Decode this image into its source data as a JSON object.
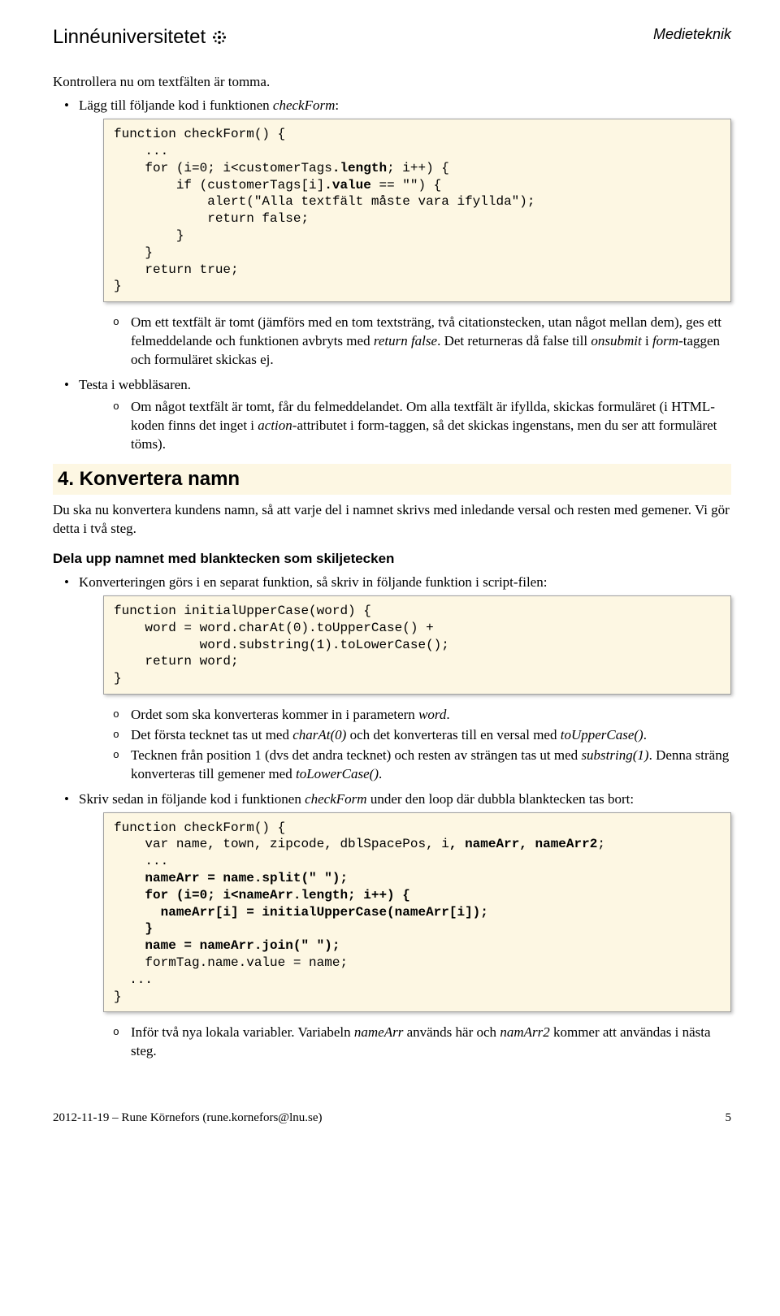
{
  "header": {
    "logo_text": "Linnéuniversitetet",
    "right": "Medieteknik"
  },
  "intro": "Kontrollera nu om textfälten är tomma.",
  "bullet1": {
    "pre": "Lägg till följande kod i funktionen ",
    "em": "checkForm",
    "post": ":"
  },
  "code1_plain": "function checkForm() {\n    ...\n    for (i=0; i<customerTags",
  "code1_bold": ".length",
  "code1_plain2": "; i++) {\n        if (customerTags[i]",
  "code1_bold2": ".value",
  "code1_plain3": " == \"\") {\n            alert(\"Alla textfält måste vara ifyllda\");\n            return false;\n        }\n    }\n    return true;\n}",
  "sub1": {
    "a": "Om ett textfält är tomt (jämförs med en tom textsträng, två citationstecken, utan något mellan dem), ges ett felmeddelande och funktionen avbryts med ",
    "a_em": "return false",
    "a2": ". Det returneras då false till ",
    "a_em2": "onsubmit",
    "a3": " i ",
    "a_em3": "form",
    "a4": "-taggen och formuläret skickas ej."
  },
  "bullet2": "Testa i webbläsaren.",
  "sub2": {
    "a": "Om något textfält är tomt, får du felmeddelandet. Om alla textfält är ifyllda, skickas formuläret (i HTML-koden finns det inget i ",
    "a_em": "action",
    "a2": "-attributet i form-taggen, så det skickas ingenstans, men du ser att formuläret töms)."
  },
  "section4": "4. Konvertera namn",
  "section4_para": "Du ska nu konvertera kundens namn, så att varje del i namnet skrivs med inledande versal och resten med gemener. Vi gör detta i två steg.",
  "subsection_h": "Dela upp namnet med blanktecken som skiljetecken",
  "bullet3": "Konverteringen görs i en separat funktion, så skriv in följande funktion i script-filen:",
  "code2": "function initialUpperCase(word) {\n    word = word.charAt(0).toUpperCase() +\n           word.substring(1).toLowerCase();\n    return word;\n}",
  "sub3": {
    "a": "Ordet som ska konverteras kommer in i parametern ",
    "a_em": "word",
    "a2": ".",
    "b": "Det första tecknet tas ut med ",
    "b_em": "charAt(0)",
    "b2": " och det konverteras till en versal med ",
    "b_em2": "toUpperCase()",
    "b3": ".",
    "c": "Tecknen från position 1 (dvs det andra tecknet) och resten av strängen tas ut med ",
    "c_em": "substring(1)",
    "c2": ". Denna sträng konverteras till gemener med ",
    "c_em2": "toLowerCase()",
    "c3": "."
  },
  "bullet4": {
    "pre": "Skriv sedan in följande kod i funktionen ",
    "em": "checkForm",
    "post": " under den loop där dubbla blanktecken tas bort:"
  },
  "code3_a": "function checkForm() {\n    var name, town, zipcode, dblSpacePos, i",
  "code3_bold": ", nameArr, nameArr2",
  "code3_b": ";\n    ...\n    ",
  "code3_bold2": "nameArr = name.split(\" \");\n    for (i=0; i<nameArr.length; i++) {\n      nameArr[i] = initialUpperCase(nameArr[i]);\n    }\n    name = nameArr.join(\" \");",
  "code3_c": "\n    formTag.name.value = name;\n  ...\n}",
  "sub4": {
    "a": "Inför två nya lokala variabler. Variabeln ",
    "a_em": "nameArr",
    "a2": " används här och ",
    "a_em2": "namArr2",
    "a3": " kommer att användas i nästa steg."
  },
  "footer": {
    "left": "2012-11-19 – Rune Körnefors (rune.kornefors@lnu.se)",
    "right": "5"
  }
}
